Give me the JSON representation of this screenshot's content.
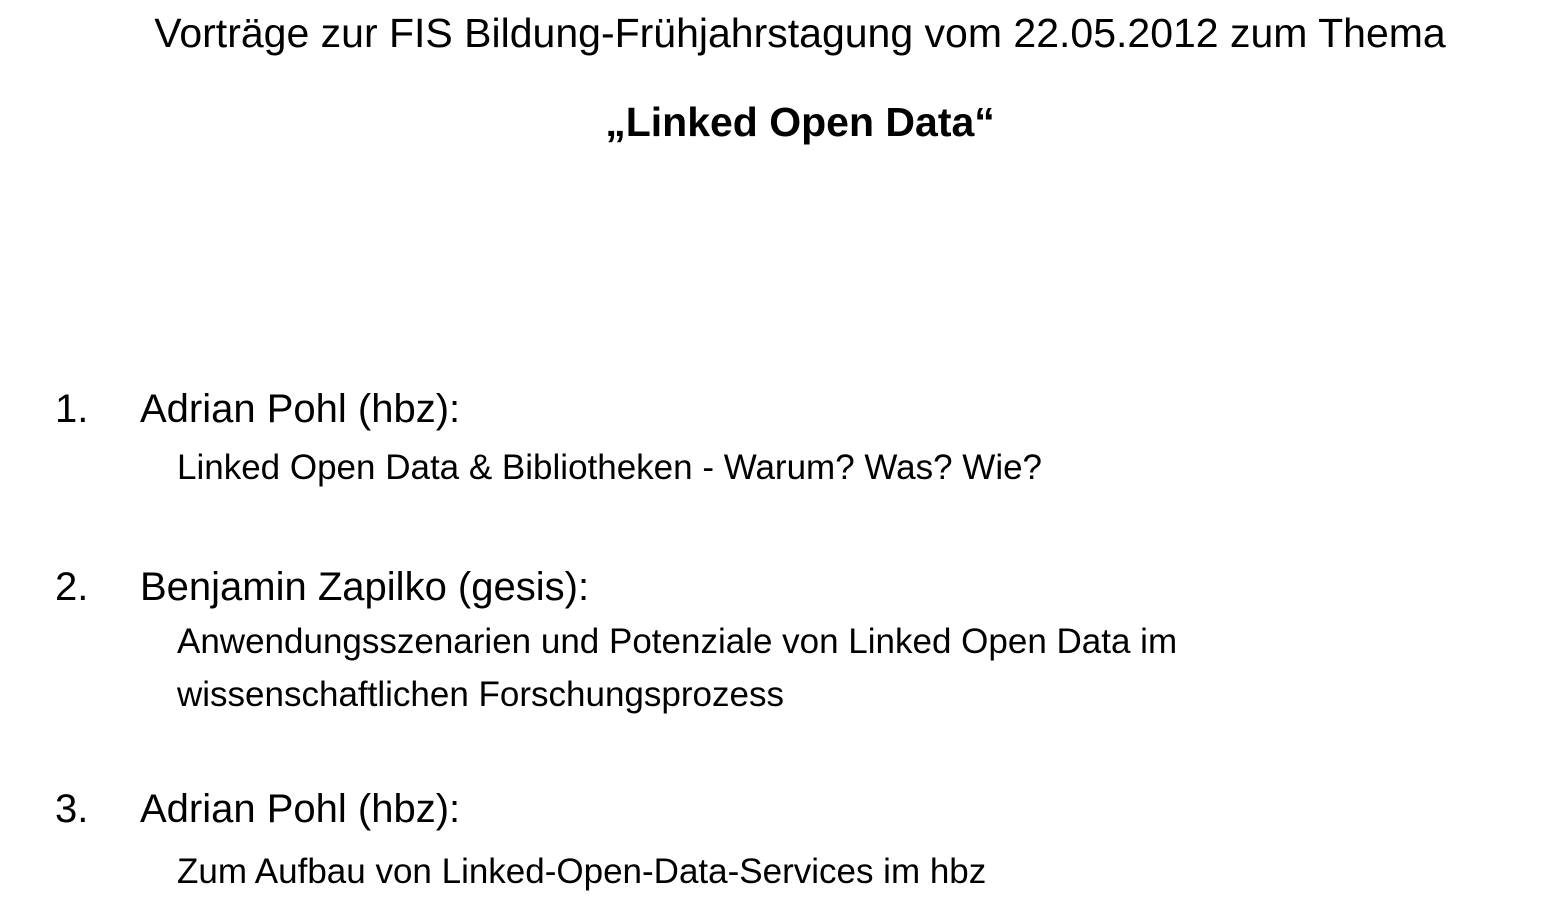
{
  "slide": {
    "title": "Vorträge zur FIS Bildung-Frühjahrstagung vom 22.05.2012 zum Thema",
    "subtitle": "„Linked Open Data“"
  },
  "agenda": {
    "items": [
      {
        "number": "1.",
        "speaker": "Adrian Pohl (hbz):",
        "talk": "Linked Open Data & Bibliotheken - Warum? Was? Wie?"
      },
      {
        "number": "2.",
        "speaker": "Benjamin Zapilko (gesis):",
        "talk": "Anwendungsszenarien und Potenziale von Linked Open Data im wissenschaftlichen Forschungsprozess"
      },
      {
        "number": "3.",
        "speaker": "Adrian Pohl (hbz):",
        "talk": "Zum Aufbau von Linked-Open-Data-Services im hbz"
      }
    ]
  }
}
